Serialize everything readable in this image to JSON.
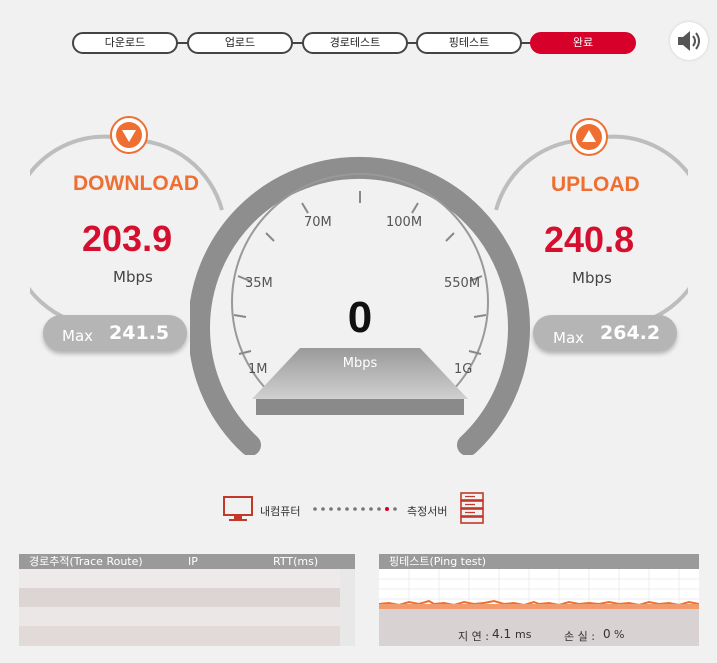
{
  "steps": {
    "items": [
      {
        "label": "다운로드",
        "active": false
      },
      {
        "label": "업로드",
        "active": false
      },
      {
        "label": "경로테스트",
        "active": false
      },
      {
        "label": "핑테스트",
        "active": false
      },
      {
        "label": "완료",
        "active": true
      }
    ]
  },
  "download": {
    "title": "DOWNLOAD",
    "value": "203.9",
    "unit": "Mbps",
    "max_label": "Max",
    "max_value": "241.5"
  },
  "upload": {
    "title": "UPLOAD",
    "value": "240.8",
    "unit": "Mbps",
    "max_label": "Max",
    "max_value": "264.2"
  },
  "gauge": {
    "value": "0",
    "unit": "Mbps",
    "ticks": {
      "t1": "1M",
      "t35": "35M",
      "t70": "70M",
      "t100": "100M",
      "t550": "550M",
      "t1g": "1G"
    }
  },
  "legend": {
    "my_computer": "내컴퓨터",
    "server": "측정서버"
  },
  "trace": {
    "header": {
      "route": "경로추적(Trace Route)",
      "ip": "IP",
      "rtt": "RTT(ms)"
    }
  },
  "ping": {
    "header": "핑테스트(Ping test)",
    "latency_label": "지 연 :",
    "latency_value": "4.1",
    "latency_unit": "ms",
    "loss_label": "손 실 :",
    "loss_value": "0",
    "loss_unit": "%"
  },
  "colors": {
    "accent_red": "#d6002a",
    "orange": "#ee6f31",
    "value_red": "#d4102e",
    "gray": "#9a9a9a"
  }
}
